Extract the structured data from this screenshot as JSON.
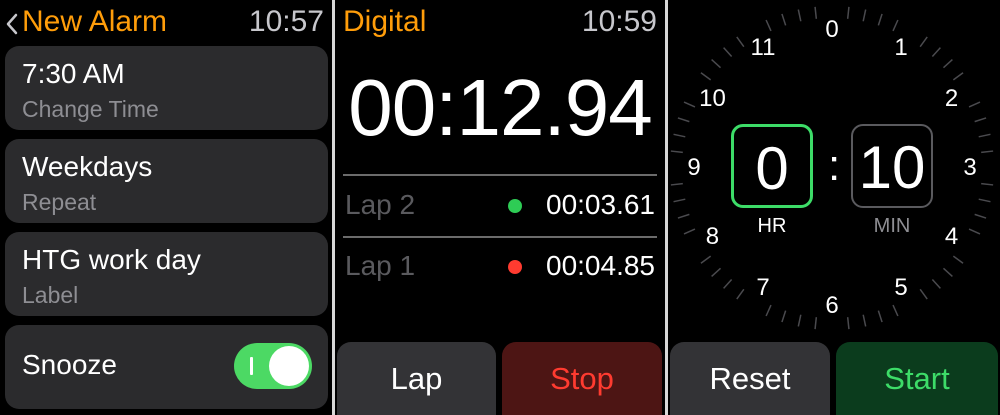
{
  "alarm": {
    "title": "New Alarm",
    "time": "10:57",
    "rows": [
      {
        "main": "7:30 AM",
        "sub": "Change Time"
      },
      {
        "main": "Weekdays",
        "sub": "Repeat"
      },
      {
        "main": "HTG work day",
        "sub": "Label"
      }
    ],
    "snooze_label": "Snooze",
    "snooze_on": true
  },
  "stopwatch": {
    "title": "Digital",
    "time": "10:59",
    "elapsed": "00:12.94",
    "laps": [
      {
        "label": "Lap 2",
        "time": "00:03.61",
        "dot_color": "#2ecc55"
      },
      {
        "label": "Lap 1",
        "time": "00:04.85",
        "dot_color": "#ff3b30"
      }
    ],
    "lap_label": "Lap",
    "stop_label": "Stop"
  },
  "timer": {
    "dial_numbers": [
      "0",
      "1",
      "2",
      "3",
      "4",
      "5",
      "6",
      "7",
      "8",
      "9",
      "10",
      "11"
    ],
    "hours": "0",
    "minutes": "10",
    "separator": ":",
    "hr_label": "HR",
    "min_label": "MIN",
    "reset_label": "Reset",
    "start_label": "Start"
  },
  "colors": {
    "accent_orange": "#ff9d0a",
    "toggle_green": "#4cd964",
    "stop_red": "#ff3b30",
    "stop_bg": "#4d1514",
    "start_green": "#3ddc68",
    "start_bg": "#0b3c1d",
    "selected_green": "#3ddc68"
  }
}
